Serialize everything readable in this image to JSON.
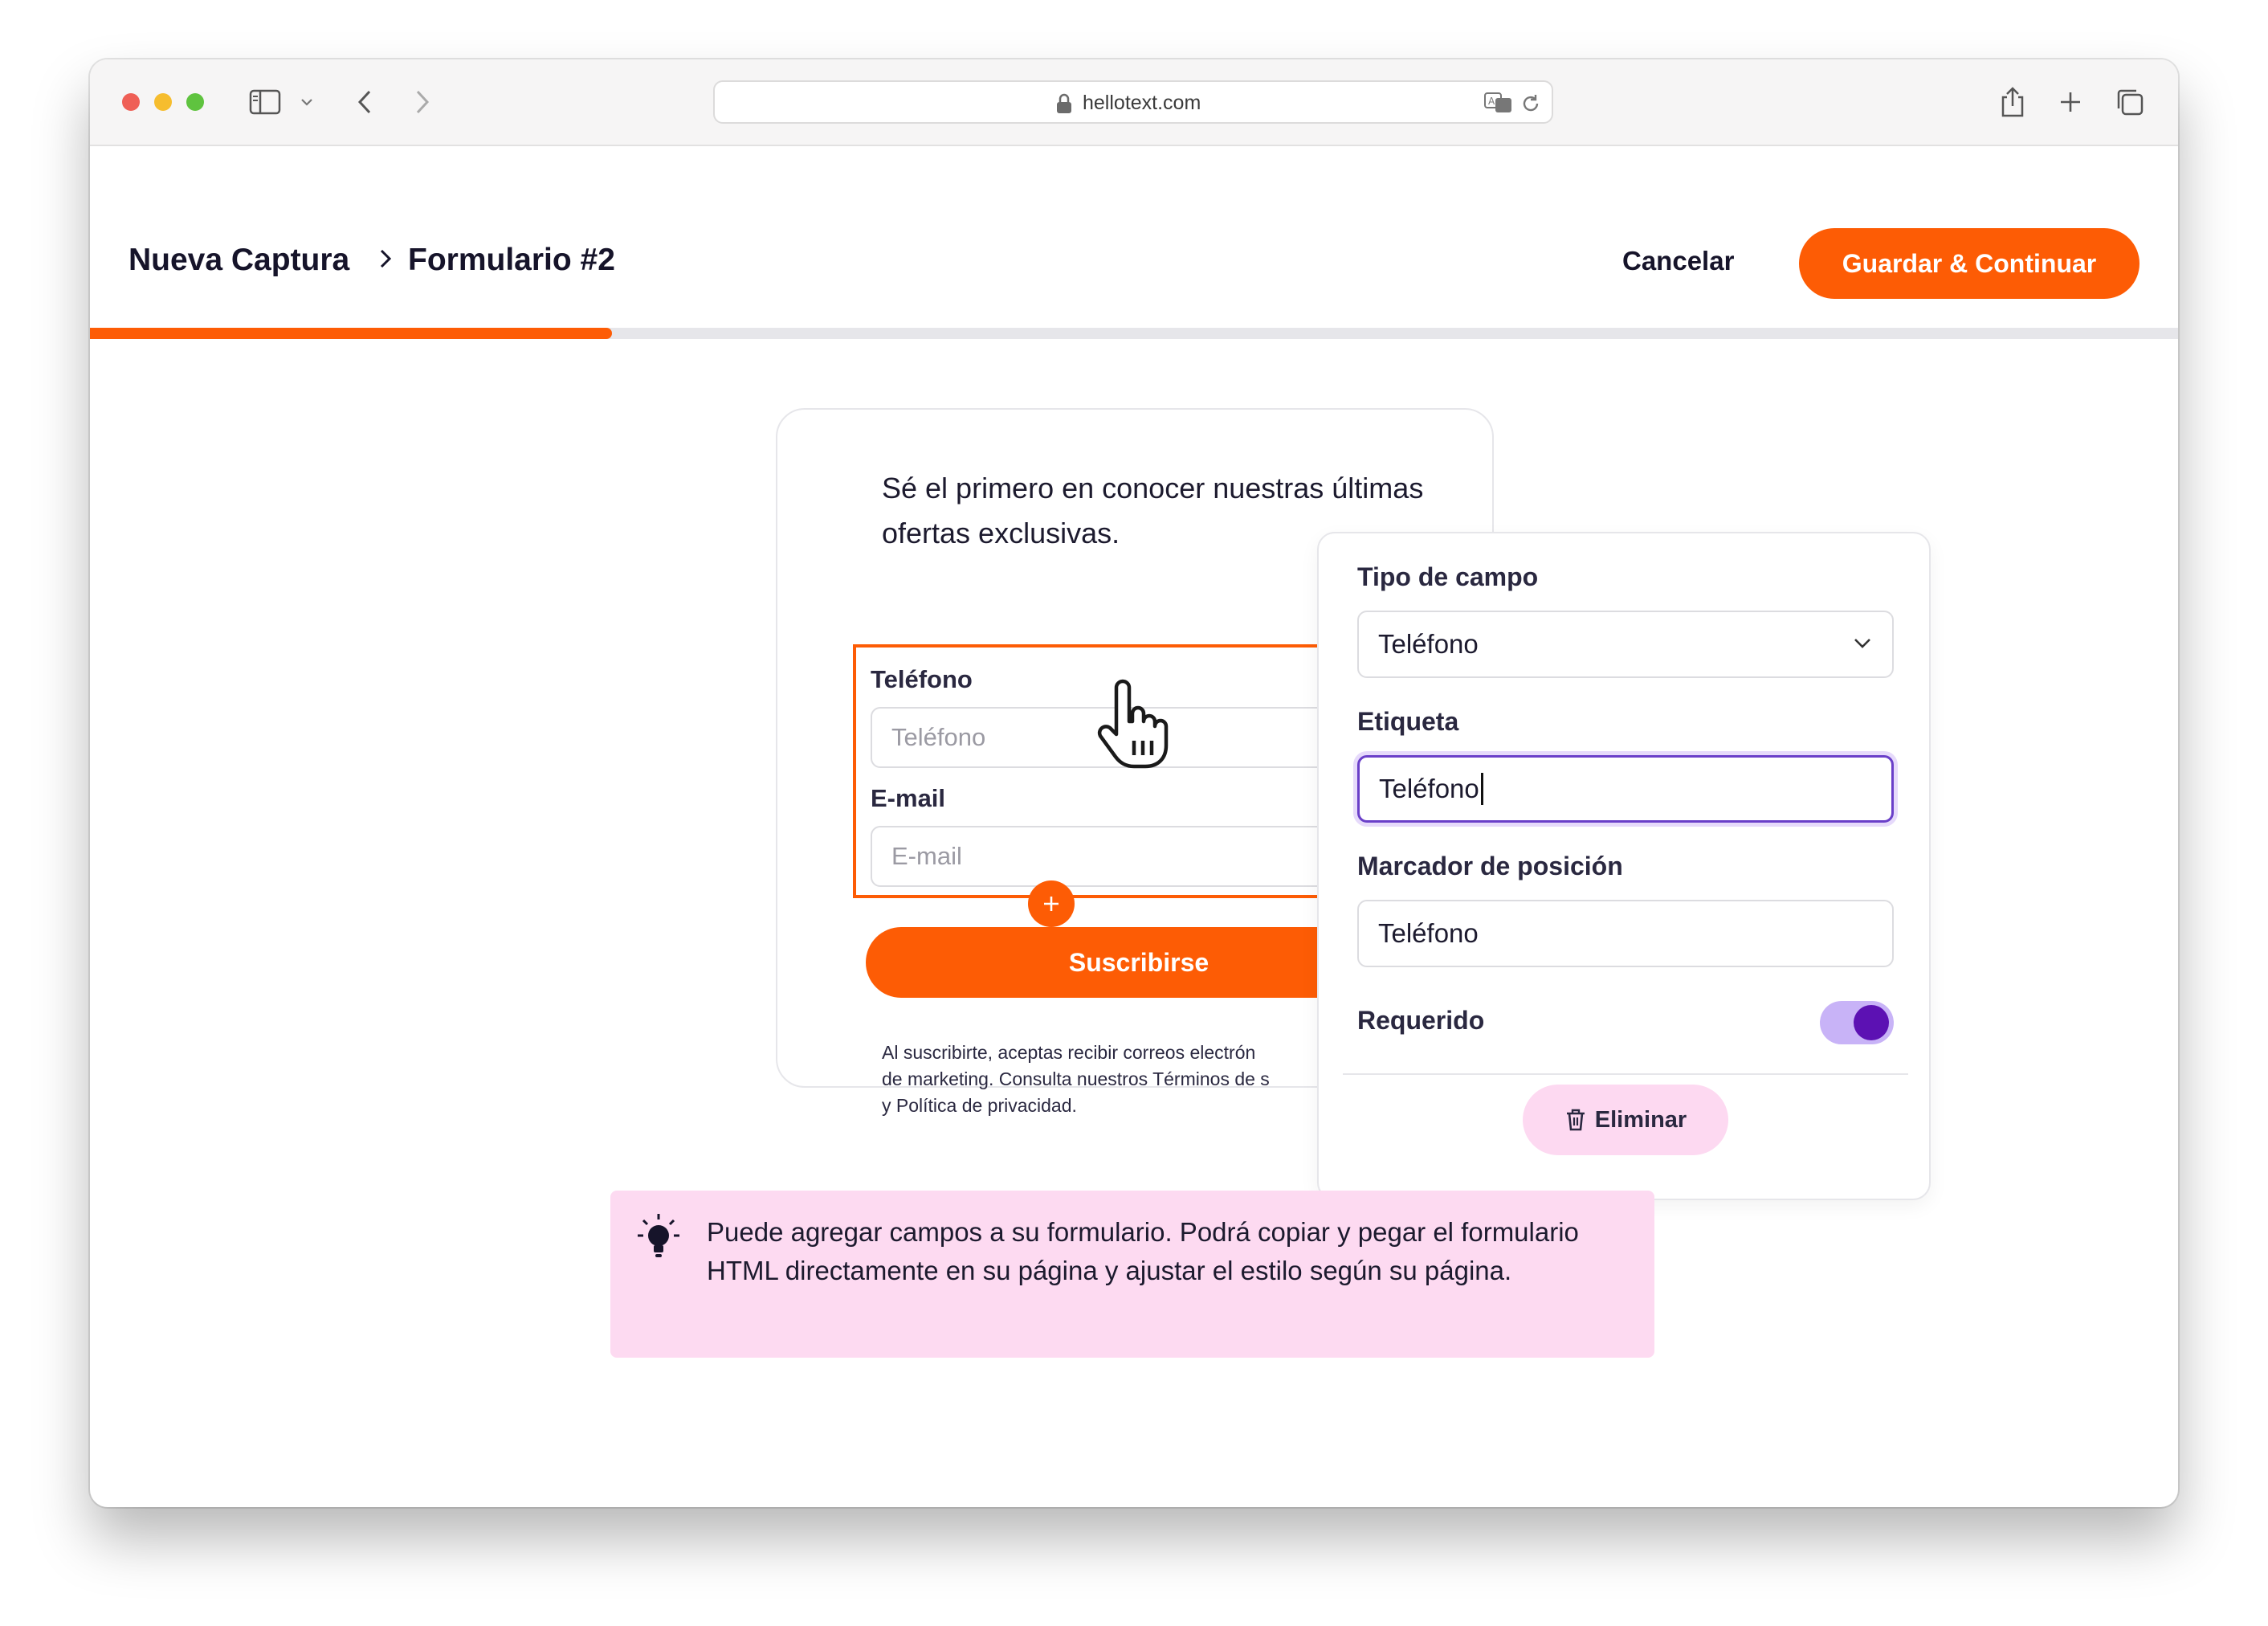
{
  "browser": {
    "url": "hellotext.com"
  },
  "header": {
    "breadcrumb_root": "Nueva Captura",
    "breadcrumb_current": "Formulario #2",
    "cancel_label": "Cancelar",
    "save_label": "Guardar & Continuar",
    "progress": 0.25
  },
  "form": {
    "heading": "Sé el primero en conocer nuestras últimas ofertas exclusivas.",
    "fields": [
      {
        "label": "Teléfono",
        "placeholder": "Teléfono"
      },
      {
        "label": "E-mail",
        "placeholder": "E-mail"
      }
    ],
    "submit_label": "Suscribirse",
    "legal_lines": [
      "Al suscribirte, aceptas recibir correos electrón",
      "de marketing. Consulta nuestros Términos de s",
      "y Política de privacidad."
    ]
  },
  "panel": {
    "field_type_label": "Tipo de campo",
    "field_type_value": "Teléfono",
    "label_label": "Etiqueta",
    "label_value": "Teléfono",
    "placeholder_label": "Marcador de posición",
    "placeholder_value": "Teléfono",
    "required_label": "Requerido",
    "required": true,
    "delete_label": "Eliminar"
  },
  "tip": {
    "text": "Puede agregar campos a su formulario. Podrá copiar y pegar el formulario HTML directamente en su página y ajustar el estilo según su página."
  },
  "colors": {
    "accent": "#fd5c05",
    "toggle_on": "#5c11b3",
    "toggle_track": "#c8b3f7",
    "tip_background": "#fddaf1",
    "focus_border": "#6a3fc9"
  },
  "icons": [
    "lock-icon",
    "translate-icon",
    "reload-icon",
    "sidebar-icon",
    "chevron-down-icon",
    "back-icon",
    "forward-icon",
    "share-icon",
    "plus-icon",
    "tabs-icon",
    "chevron-right-icon",
    "hand-cursor-icon",
    "trash-icon",
    "lightbulb-icon"
  ]
}
